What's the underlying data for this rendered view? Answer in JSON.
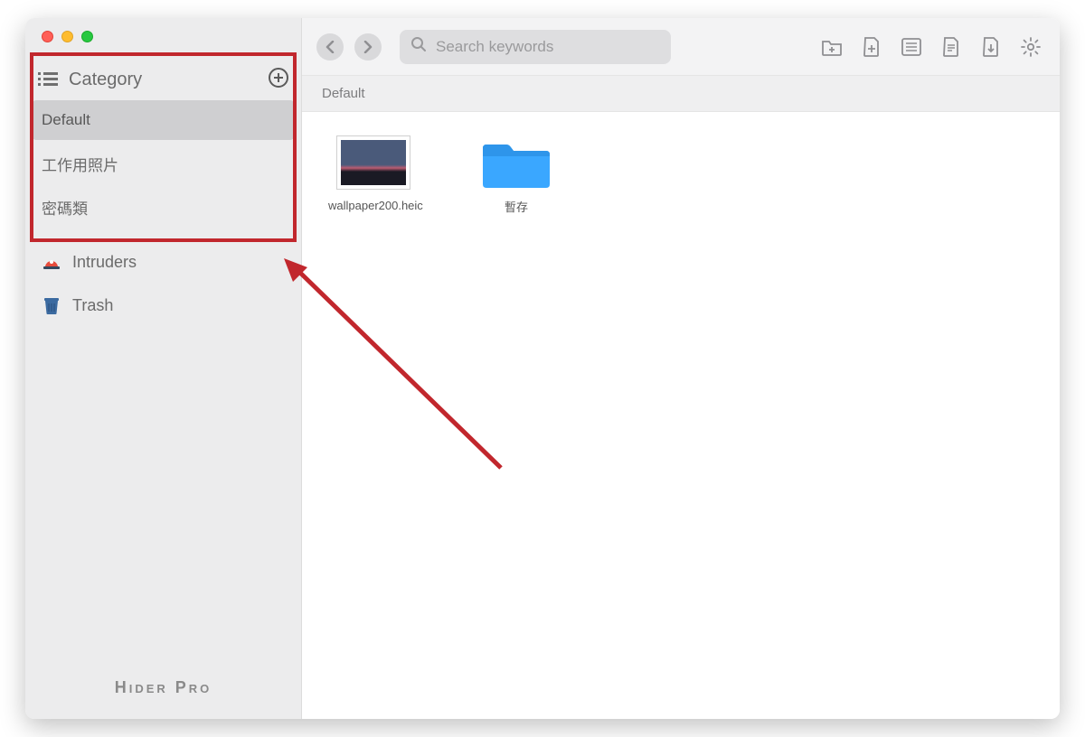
{
  "sidebar": {
    "category_header": "Category",
    "items": [
      {
        "label": "Default",
        "selected": true
      },
      {
        "label": "工作用照片",
        "selected": false
      },
      {
        "label": "密碼類",
        "selected": false
      }
    ],
    "intruders_label": "Intruders",
    "trash_label": "Trash",
    "brand": "Hider Pro"
  },
  "toolbar": {
    "search_placeholder": "Search keywords",
    "icons": {
      "add_folder": "add-folder-icon",
      "add_file": "add-file-icon",
      "list_view": "list-view-icon",
      "details": "details-icon",
      "export": "export-icon",
      "settings": "gear-icon"
    }
  },
  "breadcrumb": "Default",
  "content_items": [
    {
      "type": "image",
      "label": "wallpaper200.heic"
    },
    {
      "type": "folder",
      "label": "暫存"
    }
  ]
}
